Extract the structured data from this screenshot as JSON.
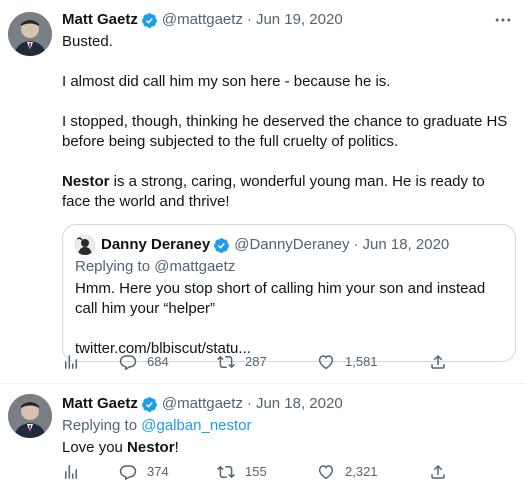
{
  "tweets": [
    {
      "name": "Matt Gaetz",
      "handle": "@mattgaetz",
      "separator": "·",
      "date": "Jun 19, 2020",
      "paragraphs": {
        "p1": "Busted.",
        "p2": "I almost did call him my son here - because he is.",
        "p3": "I stopped, though, thinking he deserved the chance to graduate HS before being subjected to the full cruelty of politics.",
        "p4_bold": "Nestor",
        "p4_rest": " is a strong, caring, wonderful young man. He is ready to face the world and thrive!"
      },
      "quote": {
        "name": "Danny Deraney",
        "handle": "@DannyDeraney",
        "separator": "·",
        "date": "Jun 18, 2020",
        "replying_prefix": "Replying to ",
        "replying_handle": "@mattgaetz",
        "text": "Hmm. Here you stop short of calling him your son and instead call him your “helper”",
        "link": "twitter.com/blbiscut/statu..."
      },
      "stats": {
        "replies": "684",
        "retweets": "287",
        "likes": "1,581"
      }
    },
    {
      "name": "Matt Gaetz",
      "handle": "@mattgaetz",
      "separator": "·",
      "date": "Jun 18, 2020",
      "replying_prefix": "Replying to ",
      "replying_handle": "@galban_nestor",
      "text_pre": "Love you ",
      "text_bold": "Nestor",
      "text_post": "!",
      "stats": {
        "replies": "374",
        "retweets": "155",
        "likes": "2,321"
      }
    }
  ],
  "icons": {
    "verified": "verified-badge-icon",
    "more": "more-icon",
    "analytics": "analytics-icon",
    "reply": "reply-icon",
    "retweet": "retweet-icon",
    "like": "like-icon",
    "share": "share-icon"
  },
  "colors": {
    "verified": "#1d9bf0",
    "link": "#1d9bf0",
    "secondary_text": "#536471",
    "border": "#cfd9de"
  }
}
